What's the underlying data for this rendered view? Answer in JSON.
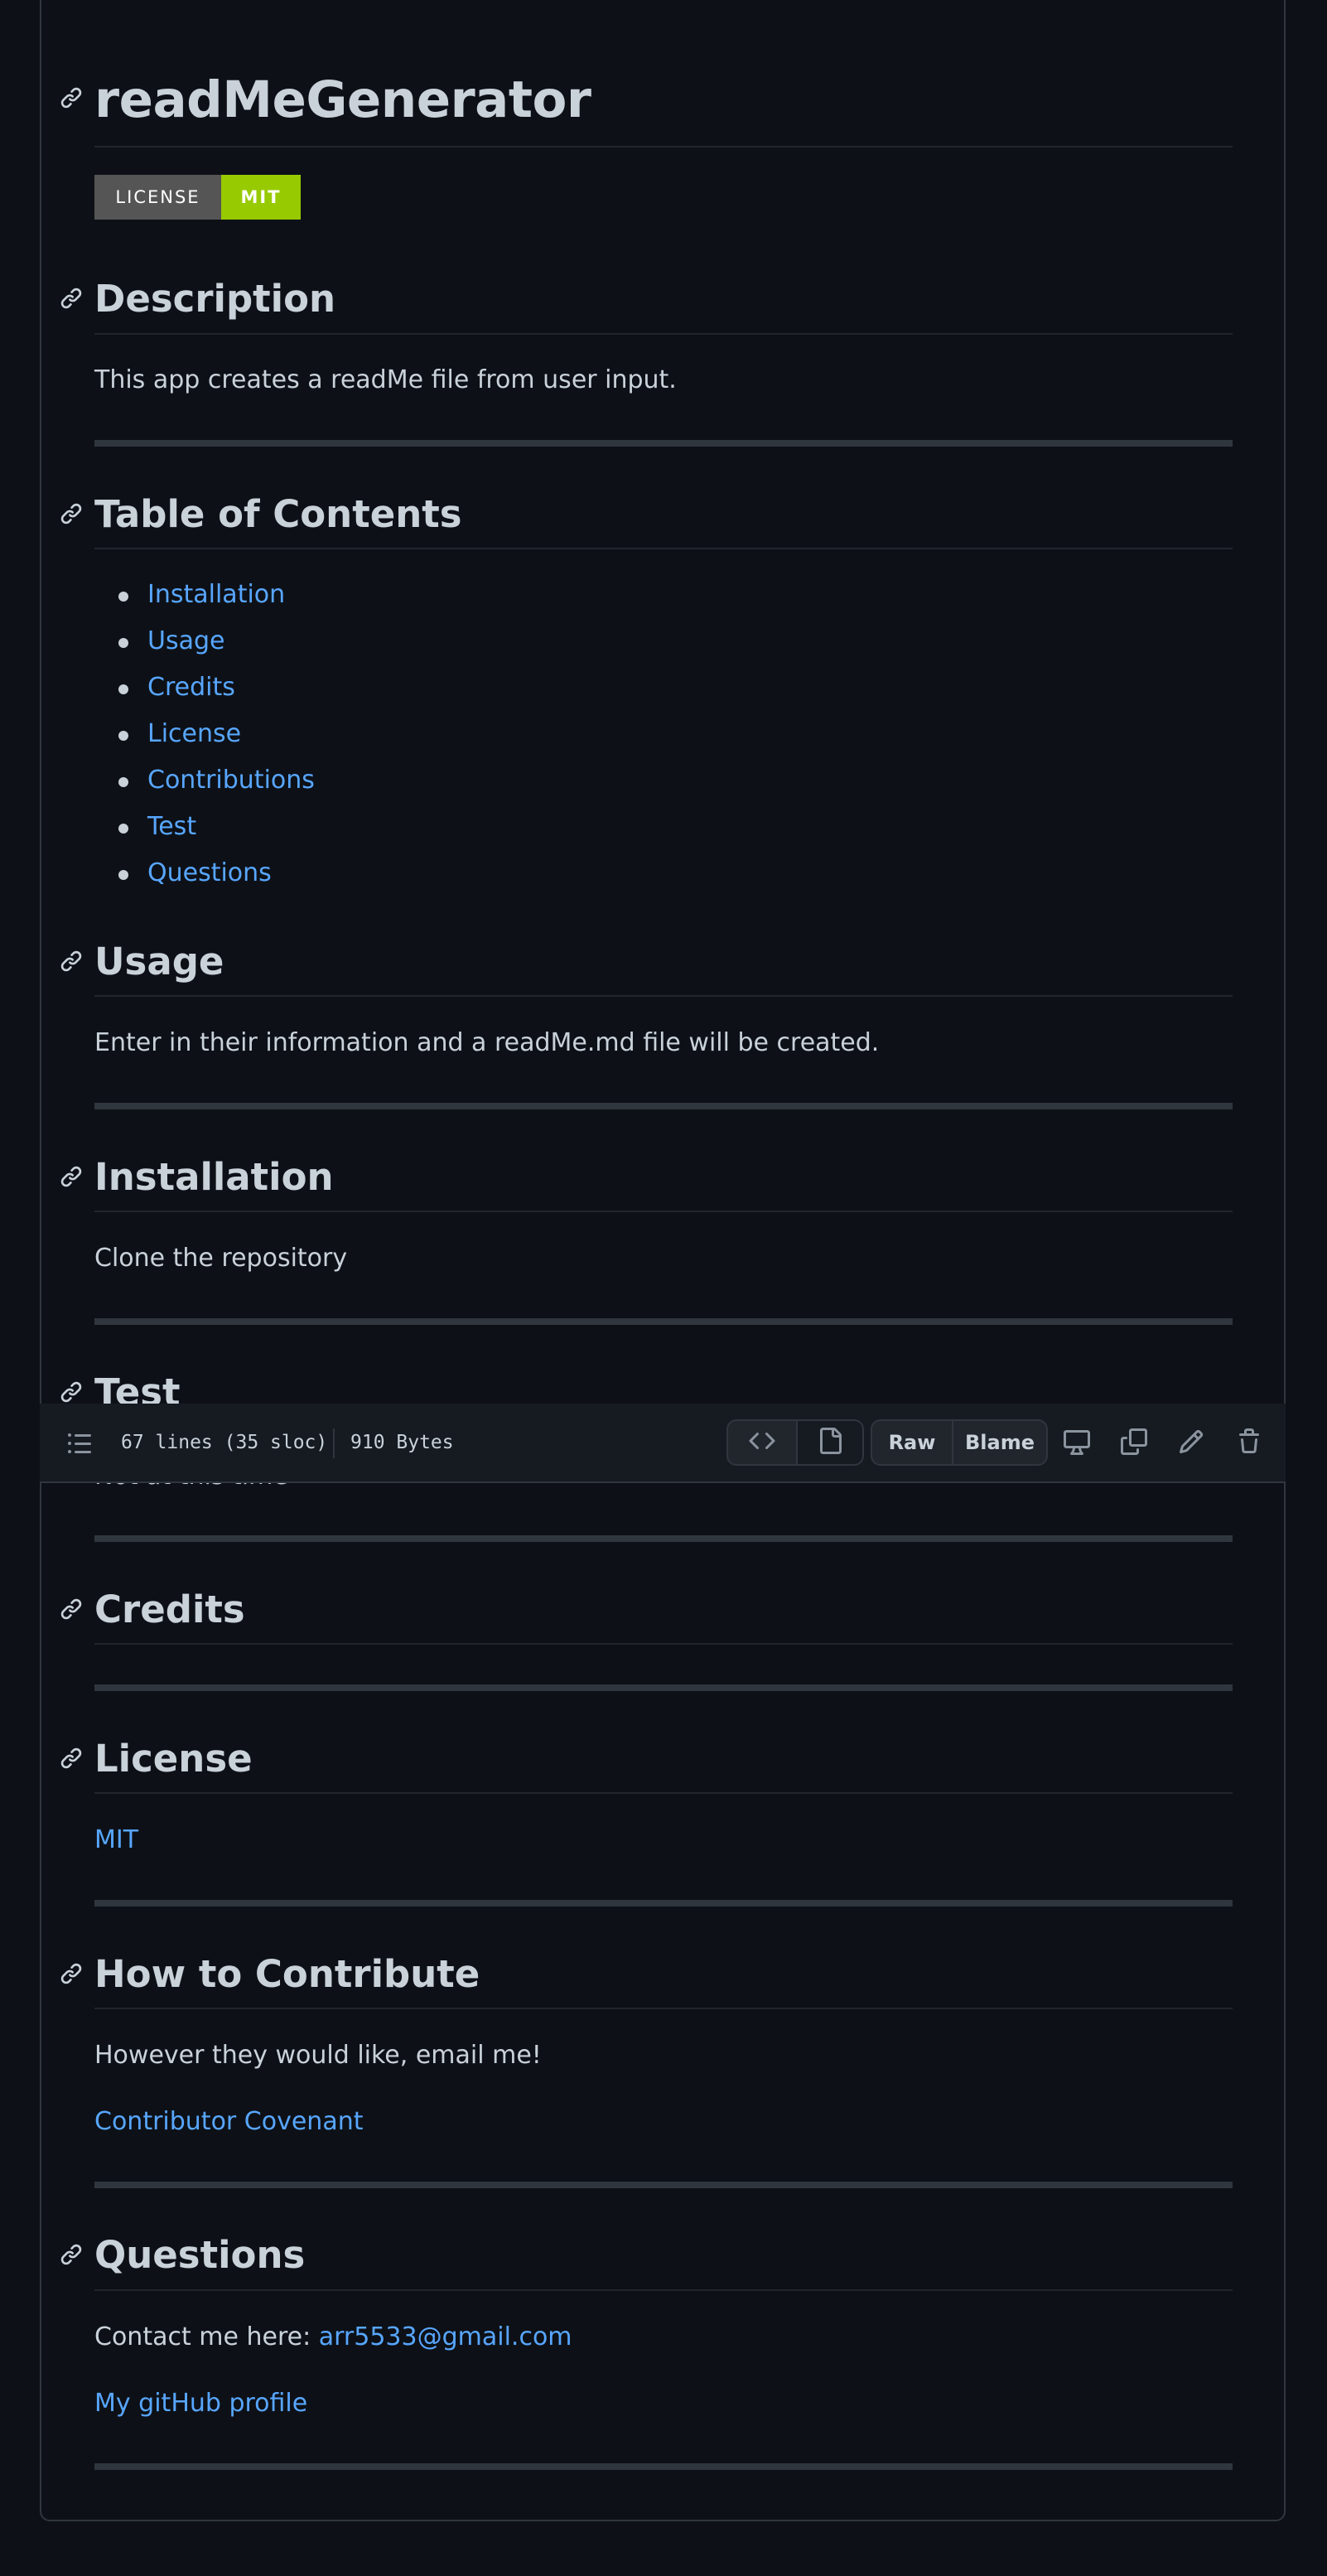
{
  "toolbar": {
    "lines_info": "67 lines (35 sloc)",
    "size_info": "910 Bytes",
    "raw_label": "Raw",
    "blame_label": "Blame",
    "icons": [
      "outline-list-icon",
      "code-icon",
      "file-icon",
      "desktop-icon",
      "copy-icon",
      "pencil-icon",
      "trash-icon"
    ]
  },
  "readme": {
    "title": "readMeGenerator",
    "badge": {
      "label": "LICENSE",
      "value": "MIT",
      "label_color": "#555555",
      "value_color": "#97ca00"
    },
    "description": {
      "heading": "Description",
      "text": "This app creates a readMe file from user input."
    },
    "toc": {
      "heading": "Table of Contents",
      "items": [
        "Installation",
        "Usage",
        "Credits",
        "License",
        "Contributions",
        "Test",
        "Questions"
      ]
    },
    "usage": {
      "heading": "Usage",
      "text": "Enter in their information and a readMe.md file will be created."
    },
    "installation": {
      "heading": "Installation",
      "text": "Clone the repository"
    },
    "test": {
      "heading": "Test",
      "text": "Not at this time"
    },
    "credits": {
      "heading": "Credits"
    },
    "license": {
      "heading": "License",
      "link": "MIT"
    },
    "contribute": {
      "heading": "How to Contribute",
      "text": "However they would like, email me!",
      "link": "Contributor Covenant"
    },
    "questions": {
      "heading": "Questions",
      "contact_prefix": "Contact me here: ",
      "email": "arr5533@gmail.com",
      "profile_link": "My gitHub profile"
    }
  },
  "colors": {
    "background": "#0d1117",
    "text": "#c9d1d9",
    "link": "#58a6ff",
    "border": "#30363d",
    "toolbar_bg": "#161b22"
  }
}
